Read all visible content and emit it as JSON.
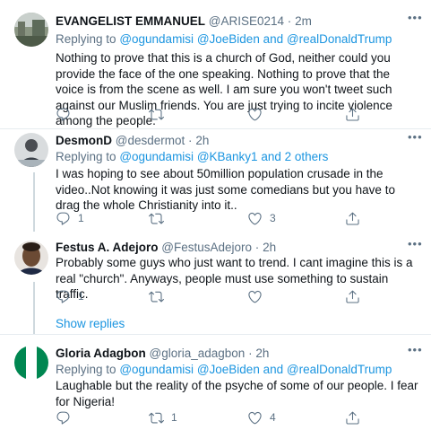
{
  "tweets": [
    {
      "name": "EVANGELIST EMMANUEL",
      "handle": "@ARISE0214",
      "dot": "·",
      "time": "2m",
      "replying_prefix": "Replying to",
      "replying_to": [
        "@ogundamisi",
        "@JoeBiden",
        "@realDonaldTrump"
      ],
      "joiner": "and",
      "text": "Nothing to prove that this is a church of God, neither could you provide the face of the one speaking. Nothing to prove that the voice is from the scene as well. I am sure you won't tweet such against our Muslim friends. You are just trying to incite violence among the people.",
      "reply_count": "",
      "retweet_count": "",
      "like_count": ""
    },
    {
      "name": "DesmonD",
      "handle": "@desdermot",
      "dot": "·",
      "time": "2h",
      "replying_prefix": "Replying to",
      "replying_to": [
        "@ogundamisi",
        "@KBanky1",
        "2 others"
      ],
      "joiner": "and",
      "text": "I was hoping to see about 50million population crusade in the video..Not knowing it was just some comedians but you have to drag the whole Christianity into it..",
      "reply_count": "1",
      "retweet_count": "",
      "like_count": "3"
    },
    {
      "name": "Festus A. Adejoro",
      "handle": "@FestusAdejoro",
      "dot": "·",
      "time": "2h",
      "text": "Probably some guys who just want to trend. I cant imagine this is a real \"church\". Anyways, people must use something to sustain traffic.",
      "reply_count": "1",
      "retweet_count": "",
      "like_count": ""
    },
    {
      "name": "Gloria Adagbon",
      "handle": "@gloria_adagbon",
      "dot": "·",
      "time": "2h",
      "replying_prefix": "Replying to",
      "replying_to": [
        "@ogundamisi",
        "@JoeBiden",
        "@realDonaldTrump"
      ],
      "joiner": "and",
      "text": "Laughable but the reality of the psyche of some of our people. I fear for Nigeria!",
      "reply_count": "",
      "retweet_count": "1",
      "like_count": "4"
    }
  ],
  "show_replies": "Show replies",
  "icons": {
    "reply": "reply-icon",
    "retweet": "retweet-icon",
    "like": "heart-icon",
    "share": "share-icon",
    "more": "more-icon"
  },
  "colors": {
    "link": "#1b95e0",
    "muted": "#5b7083",
    "divider": "#e6ecf0",
    "nigeria_green": "#008751"
  }
}
